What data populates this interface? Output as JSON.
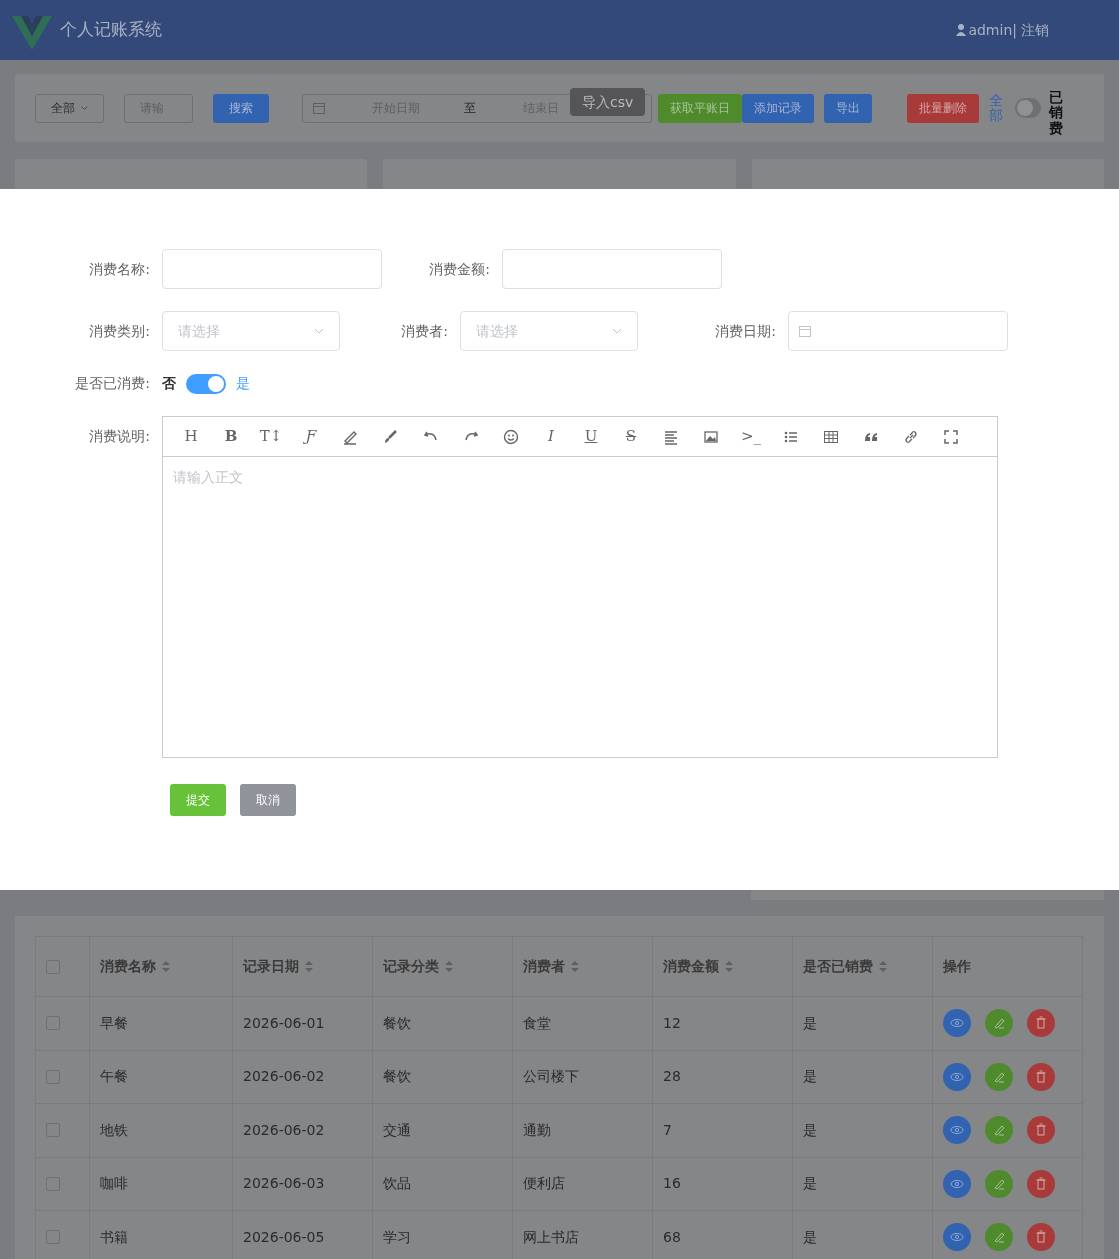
{
  "header": {
    "title": "个人记账系统",
    "user": "admin|",
    "logout": "注销"
  },
  "toolbar": {
    "category": "全部",
    "search_placeholder": "请输",
    "search_button": "搜索",
    "date_range": {
      "start": "开始日期",
      "separator": "至",
      "end": "结束日"
    },
    "tooltip": "导入csv",
    "buttons": [
      {
        "label": "获取平账日",
        "kind": "success"
      },
      {
        "label": "添加记录",
        "kind": "primary"
      },
      {
        "label": "导出",
        "kind": "primary"
      },
      {
        "label": "批量删除",
        "kind": "danger"
      }
    ],
    "filter_label": "全部",
    "switch": {
      "on": false
    },
    "switch_label": "已销费"
  },
  "form": {
    "rows": [
      [
        {
          "label": "消费名称:",
          "kind": "text"
        },
        {
          "label": "消费金额:",
          "kind": "text"
        }
      ],
      [
        {
          "label": "消费类别:",
          "kind": "select",
          "placeholder": "请选择"
        },
        {
          "label": "消费者:",
          "kind": "select",
          "placeholder": "请选择"
        },
        {
          "label": "消费日期:",
          "kind": "date"
        }
      ]
    ],
    "consumed": {
      "label": "是否已消费:",
      "off_text": "否",
      "on_text": "是",
      "on": true
    },
    "editor": {
      "label": "消费说明:",
      "placeholder": "请输入正文",
      "tools": [
        {
          "kind": "glyph",
          "glyph": "H"
        },
        {
          "kind": "glyph",
          "glyph": "B"
        },
        {
          "kind": "glyph",
          "glyph": "T↕"
        },
        {
          "kind": "glyph",
          "glyph": "Ƒ"
        },
        {
          "kind": "pen"
        },
        {
          "kind": "brush"
        },
        {
          "kind": "undo"
        },
        {
          "kind": "redo"
        },
        {
          "kind": "emoji"
        },
        {
          "kind": "glyph",
          "glyph": "I"
        },
        {
          "kind": "glyph",
          "glyph": "U"
        },
        {
          "kind": "glyph",
          "glyph": "S"
        },
        {
          "kind": "align"
        },
        {
          "kind": "image"
        },
        {
          "kind": "glyph",
          "glyph": ">_"
        },
        {
          "kind": "list"
        },
        {
          "kind": "table"
        },
        {
          "kind": "quote"
        },
        {
          "kind": "link"
        },
        {
          "kind": "fullscreen"
        }
      ]
    },
    "buttons": [
      {
        "label": "提交",
        "kind": "success"
      },
      {
        "label": "取消",
        "kind": "neutral"
      }
    ]
  },
  "table": {
    "select_all_checked": false,
    "columns": [
      "消费名称",
      "记录日期",
      "记录分类",
      "消费者",
      "消费金额",
      "是否已销费",
      "操作"
    ],
    "rows": [
      {
        "checked": false,
        "cells": [
          "早餐",
          "2026-06-01",
          "餐饮",
          "食堂",
          "12",
          "是"
        ]
      },
      {
        "checked": false,
        "cells": [
          "午餐",
          "2026-06-02",
          "餐饮",
          "公司楼下",
          "28",
          "是"
        ]
      },
      {
        "checked": false,
        "cells": [
          "地铁",
          "2026-06-02",
          "交通",
          "通勤",
          "7",
          "是"
        ]
      },
      {
        "checked": false,
        "cells": [
          "咖啡",
          "2026-06-03",
          "饮品",
          "便利店",
          "16",
          "是"
        ]
      },
      {
        "checked": false,
        "cells": [
          "书籍",
          "2026-06-05",
          "学习",
          "网上书店",
          "68",
          "是"
        ]
      }
    ]
  }
}
